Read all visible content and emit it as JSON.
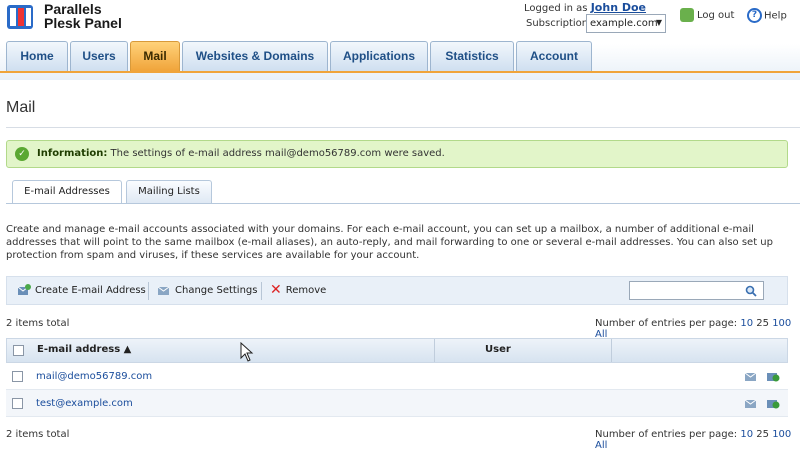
{
  "app": {
    "name_line1": "Parallels",
    "name_line2": "Plesk Panel"
  },
  "user": {
    "logged_prefix": "Logged in as",
    "name": "John Doe"
  },
  "subscription": {
    "label": "Subscription",
    "value": "example.com"
  },
  "header_links": {
    "logout": "Log out",
    "help": "Help"
  },
  "tabs": [
    {
      "label": "Home"
    },
    {
      "label": "Users"
    },
    {
      "label": "Mail"
    },
    {
      "label": "Websites & Domains"
    },
    {
      "label": "Applications"
    },
    {
      "label": "Statistics"
    },
    {
      "label": "Account"
    }
  ],
  "active_tab": "Mail",
  "page": {
    "title": "Mail"
  },
  "info": {
    "label": "Information:",
    "message": "The settings of e-mail address mail@demo56789.com were saved."
  },
  "subtabs": [
    {
      "label": "E-mail Addresses"
    },
    {
      "label": "Mailing Lists"
    }
  ],
  "description": "Create and manage e-mail accounts associated with your domains. For each e-mail account, you can set up a mailbox, a number of additional e-mail addresses that will point to the same mailbox (e-mail aliases), an auto-reply, and mail forwarding to one or several e-mail addresses. You can also set up protection from spam and viruses, if these services are available for your account.",
  "toolbar": {
    "create": "Create E-mail Address",
    "change": "Change Settings",
    "remove": "Remove"
  },
  "list": {
    "total": "2 items total",
    "per_page_label": "Number of entries per page:",
    "per_page_options": [
      "10",
      "25",
      "100",
      "All"
    ],
    "columns": {
      "email": "E-mail address ▲",
      "user": "User"
    },
    "rows": [
      {
        "email": "mail@demo56789.com",
        "user": ""
      },
      {
        "email": "test@example.com",
        "user": ""
      }
    ]
  },
  "colors": {
    "accent_tab": "#f0a43a",
    "info_bg": "#e2f5c9",
    "link": "#1a4d9c"
  }
}
